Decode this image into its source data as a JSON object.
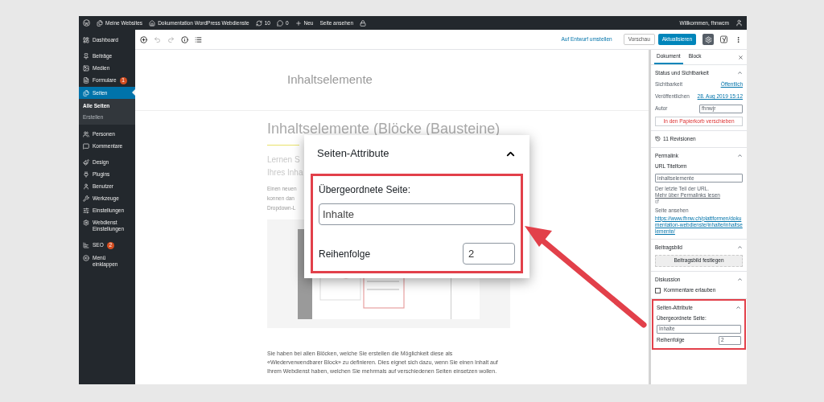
{
  "admin_bar": {
    "sites": "Meine Websites",
    "site_name": "Dokumentation WordPress Webdienste",
    "updates": "10",
    "comments": "0",
    "new": "Neu",
    "view_page": "Seite ansehen",
    "greeting": "Willkommen, fhnwcm"
  },
  "sidebar": {
    "groups": [
      [
        {
          "label": "Dashboard",
          "selected": false
        }
      ],
      [
        {
          "label": "Beiträge",
          "selected": false
        },
        {
          "label": "Medien",
          "selected": false
        },
        {
          "label": "Formulare",
          "badge": "1",
          "selected": false
        },
        {
          "label": "Seiten",
          "selected": true,
          "children": [
            {
              "label": "Alle Seiten",
              "selected": true
            },
            {
              "label": "Erstellen",
              "selected": false
            }
          ]
        }
      ],
      [
        {
          "label": "Personen",
          "selected": false
        },
        {
          "label": "Kommentare",
          "selected": false
        }
      ],
      [
        {
          "label": "Design",
          "selected": false
        },
        {
          "label": "Plugins",
          "selected": false
        },
        {
          "label": "Benutzer",
          "selected": false
        },
        {
          "label": "Werkzeuge",
          "selected": false
        },
        {
          "label": "Einstellungen",
          "selected": false
        },
        {
          "label": "Webdienst Einstellungen",
          "selected": false
        }
      ],
      [
        {
          "label": "SEO",
          "badge": "2",
          "selected": false
        },
        {
          "label": "Menü einklappen",
          "selected": false
        }
      ]
    ]
  },
  "toolbar": {
    "draft_link": "Auf Entwurf umstellen",
    "preview": "Vorschau",
    "update": "Aktualisieren",
    "settings_selected": true
  },
  "content": {
    "doc_title": "Inhaltselemente",
    "heading": "Inhaltselemente (Blöcke (Bausteine)",
    "intro_fragments": [
      "Lernen S",
      "Ihres Inha"
    ],
    "paragraph_fragments": [
      "Einen neuen",
      "konnen dan",
      "Dropdown-L"
    ],
    "body": "Sie haben bei allen Blöcken, welche Sie erstellen die Möglichkeit diese als «Wiederverwendbarer Block» zu definieren. Dies eignet sich dazu, wenn Sie einen Inhalt auf Ihrem Webdienst haben, welchen Sie mehrmals auf verschiedenen Seiten einsetzen wollen."
  },
  "settings": {
    "tabs": [
      {
        "label": "Dokument",
        "selected": true
      },
      {
        "label": "Block",
        "selected": false
      }
    ],
    "status": {
      "title": "Status und Sichtbarkeit",
      "expanded": true,
      "rows": [
        {
          "kind": "link",
          "label": "Sichtbarkeit",
          "value": "Öffentlich"
        },
        {
          "kind": "link",
          "label": "Veröffentlichen",
          "value": "28. Aug 2019 15:12"
        },
        {
          "kind": "input",
          "label": "Autor",
          "value": "fhnwjr"
        }
      ],
      "trash": "In den Papierkorb verschieben"
    },
    "revisions": "11 Revisionen",
    "permalink": {
      "title": "Permalink",
      "expanded": true,
      "field_label": "URL Titelform",
      "value": "inhaltselemente",
      "help": "Der letzte Teil der URL.",
      "help_link": "Mehr über Permalinks lesen",
      "view_label": "Seite ansehen",
      "url": "https://www.fhnw.ch/plattformen/dokumentation-webdienste/inhalte/inhaltselemente/"
    },
    "featured": {
      "title": "Beitragsbild",
      "expanded": true,
      "button": "Beitragsbild festlegen"
    },
    "discussion": {
      "title": "Diskussion",
      "expanded": true,
      "label": "Kommentare erlauben",
      "checked": false
    },
    "attributes": {
      "title": "Seiten-Attribute",
      "expanded": true,
      "parent_label": "Übergeordnete Seite:",
      "parent_value": "Inhalte",
      "order_label": "Reihenfolge",
      "order_value": "2"
    }
  },
  "callout": {
    "title": "Seiten-Attribute",
    "expanded": true,
    "parent_label": "Übergeordnete Seite:",
    "parent_value": "Inhalte",
    "order_label": "Reihenfolge",
    "order_value": "2"
  }
}
